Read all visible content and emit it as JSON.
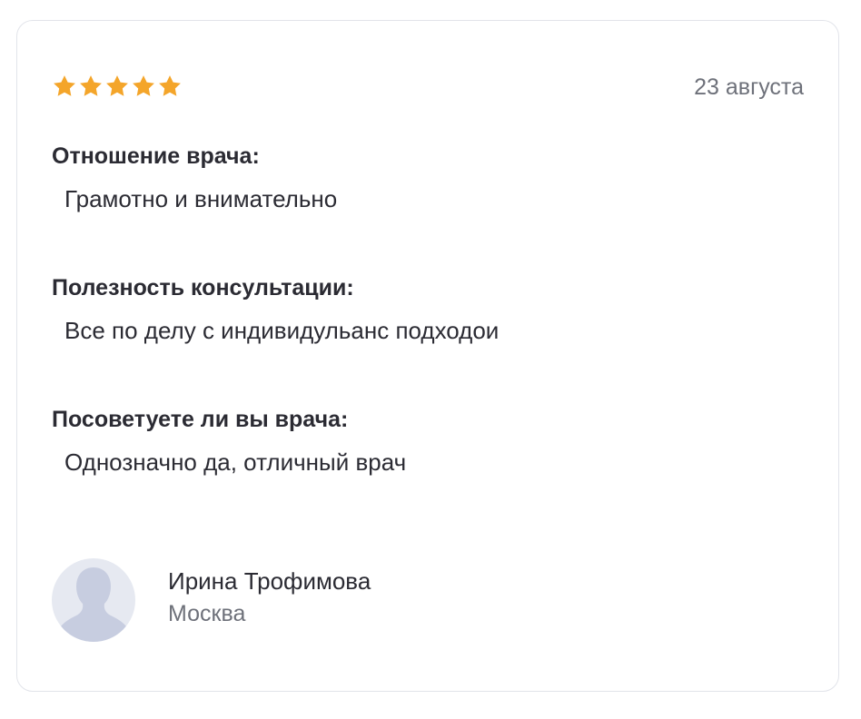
{
  "review": {
    "rating": 5,
    "rating_max": 5,
    "date": "23 августа",
    "questions": [
      {
        "question": "Отношение врача:",
        "answer": "Грамотно и внимательно"
      },
      {
        "question": "Полезность консультации:",
        "answer": "Все по делу с индивидульанс подходои"
      },
      {
        "question": "Посоветуете ли вы врача:",
        "answer": "Однозначно да, отличный врач"
      }
    ],
    "author": {
      "name": "Ирина Трофимова",
      "city": "Москва",
      "avatar_icon": "user-silhouette-icon"
    }
  },
  "colors": {
    "star": "#f4a52a",
    "text": "#2b2b33",
    "muted": "#6e717a",
    "avatar_bg": "#e6e9f1",
    "avatar_silhouette": "#c7cde0",
    "card_border": "#e2e4ea"
  }
}
